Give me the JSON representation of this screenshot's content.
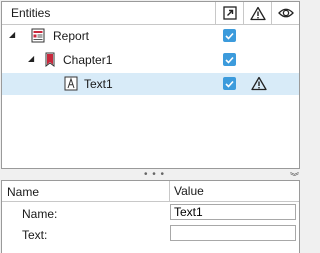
{
  "entities_panel": {
    "header_title": "Entities",
    "col_icons": [
      "expand-link-icon",
      "warning-icon",
      "eye-icon"
    ],
    "rows": [
      {
        "label": "Report",
        "icon": "report-icon",
        "checked": true,
        "warning": false,
        "expanded": true
      },
      {
        "label": "Chapter1",
        "icon": "chapter-icon",
        "checked": true,
        "warning": false,
        "expanded": true
      },
      {
        "label": "Text1",
        "icon": "text-icon",
        "checked": true,
        "warning": true,
        "selected": true
      }
    ]
  },
  "splitter": {
    "handle": "• • •"
  },
  "properties": {
    "col_name": "Name",
    "col_value": "Value",
    "rows": [
      {
        "name": "Name:",
        "value": "Text1"
      },
      {
        "name": "Text:",
        "value": ""
      }
    ]
  },
  "colors": {
    "accent": "#3c9bdc",
    "selection": "#d8ebf8",
    "chapter_red": "#c8283c"
  }
}
